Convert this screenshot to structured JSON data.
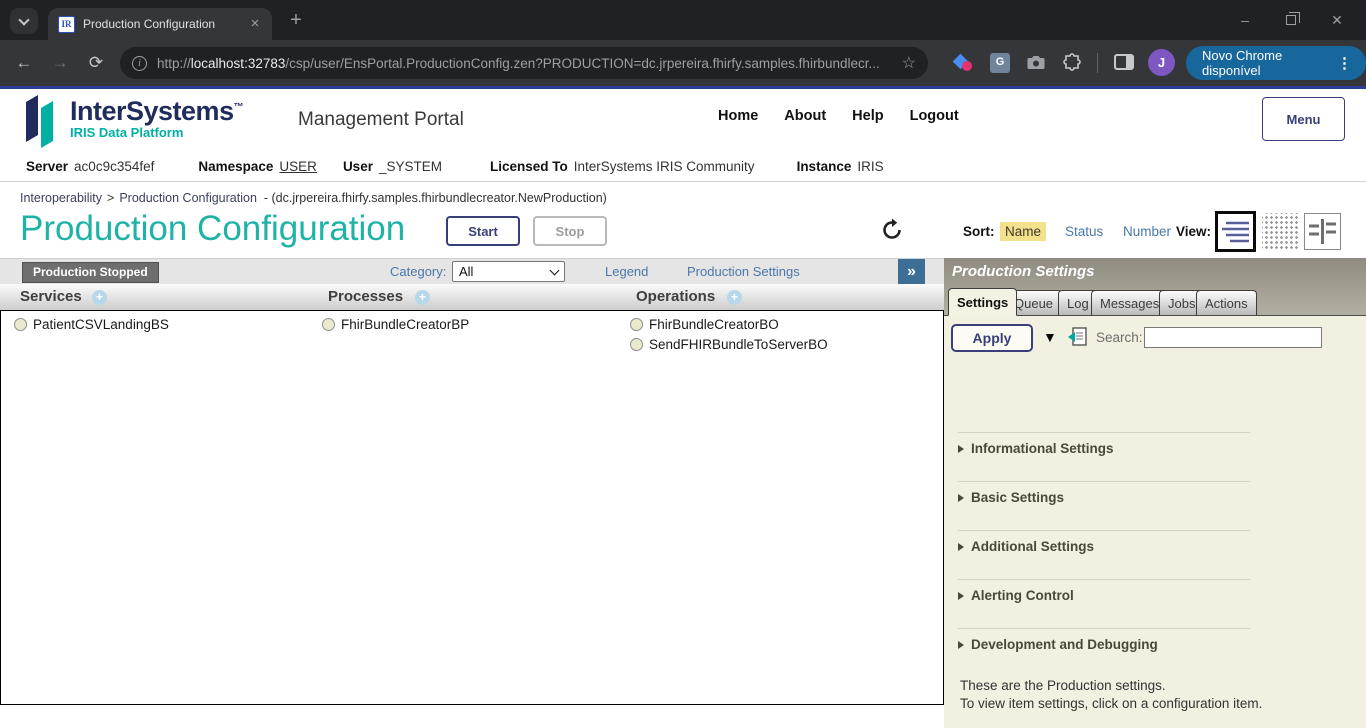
{
  "browser": {
    "tab_title": "Production Configuration",
    "favicon_text": "IR",
    "new_tab_glyph": "+",
    "close_tab_glyph": "×",
    "back_glyph": "←",
    "forward_glyph": "→",
    "reload_glyph": "⟳",
    "info_glyph": "i",
    "star_glyph": "☆",
    "url_scheme": "http://",
    "url_host": "localhost:32783",
    "url_path": "/csp/user/EnsPortal.ProductionConfig.zen?PRODUCTION=dc.jrpereira.fhirfy.samples.fhirbundlecr...",
    "translate_glyph": "G",
    "profile_initial": "J",
    "update_pill_label": "Novo Chrome disponível",
    "more_glyph": "⋮",
    "minimize_glyph": "–",
    "close_glyph": "✕"
  },
  "portal": {
    "brand": "InterSystems",
    "brand_tm": "™",
    "tagline": "IRIS Data Platform",
    "app_title": "Management Portal",
    "nav": [
      {
        "label": "Home"
      },
      {
        "label": "About"
      },
      {
        "label": "Help"
      },
      {
        "label": "Logout"
      }
    ],
    "menu_button": "Menu"
  },
  "info": {
    "items": [
      {
        "label": "Server",
        "value": "ac0c9c354fef"
      },
      {
        "label": "Namespace",
        "value": "USER"
      },
      {
        "label": "User",
        "value": "_SYSTEM"
      },
      {
        "label": "Licensed To",
        "value": "InterSystems IRIS Community"
      },
      {
        "label": "Instance",
        "value": "IRIS"
      }
    ]
  },
  "breadcrumb": {
    "link1": "Interoperability",
    "separator": ">",
    "link2": "Production Configuration",
    "suffix": "- (dc.jrpereira.fhirfy.samples.fhirbundlecreator.NewProduction)"
  },
  "page": {
    "title": "Production Configuration",
    "start_button": "Start",
    "stop_button": "Stop",
    "sort_label": "Sort:",
    "sort_options": [
      {
        "label": "Name",
        "selected": true
      },
      {
        "label": "Status",
        "selected": false
      },
      {
        "label": "Number",
        "selected": false
      }
    ],
    "view_label": "View:"
  },
  "toolbar": {
    "status_badge": "Production Stopped",
    "category_label": "Category:",
    "category_value": "All",
    "legend_link": "Legend",
    "settings_link": "Production Settings",
    "expand_glyph": "»"
  },
  "columns": [
    {
      "header": "Services",
      "add_glyph": "+",
      "items": [
        {
          "name": "PatientCSVLandingBS"
        }
      ]
    },
    {
      "header": "Processes",
      "add_glyph": "+",
      "items": [
        {
          "name": "FhirBundleCreatorBP"
        }
      ]
    },
    {
      "header": "Operations",
      "add_glyph": "+",
      "items": [
        {
          "name": "FhirBundleCreatorBO"
        },
        {
          "name": "SendFHIRBundleToServerBO"
        }
      ]
    }
  ],
  "panel": {
    "title": "Production Settings",
    "tabs": [
      {
        "label": "Settings",
        "active": true
      },
      {
        "label": "Queue",
        "active": false
      },
      {
        "label": "Log",
        "active": false
      },
      {
        "label": "Messages",
        "active": false
      },
      {
        "label": "Jobs",
        "active": false
      },
      {
        "label": "Actions",
        "active": false
      }
    ],
    "apply_button": "Apply",
    "dropdown_glyph": "▼",
    "search_label": "Search:",
    "search_value": "",
    "sections": [
      {
        "label": "Informational Settings"
      },
      {
        "label": "Basic Settings"
      },
      {
        "label": "Additional Settings"
      },
      {
        "label": "Alerting Control"
      },
      {
        "label": "Development and Debugging"
      }
    ],
    "note_line1": "These are the Production settings.",
    "note_line2": "To view item settings, click on a configuration item."
  },
  "colors": {
    "accent_teal": "#1fb3a7",
    "navy": "#3a3e79",
    "link_blue": "#4a77a8",
    "sort_selected_bg": "#f3e18e",
    "badge_bg": "#6e6e6e",
    "panel_header_bg": "#98948a",
    "panel_bg": "#f2f0e1",
    "status_circle_fill": "#e9e9cd",
    "expand_button_bg": "#3d6e96",
    "update_pill_bg": "#17679c",
    "avatar_bg": "#7e57c2"
  }
}
